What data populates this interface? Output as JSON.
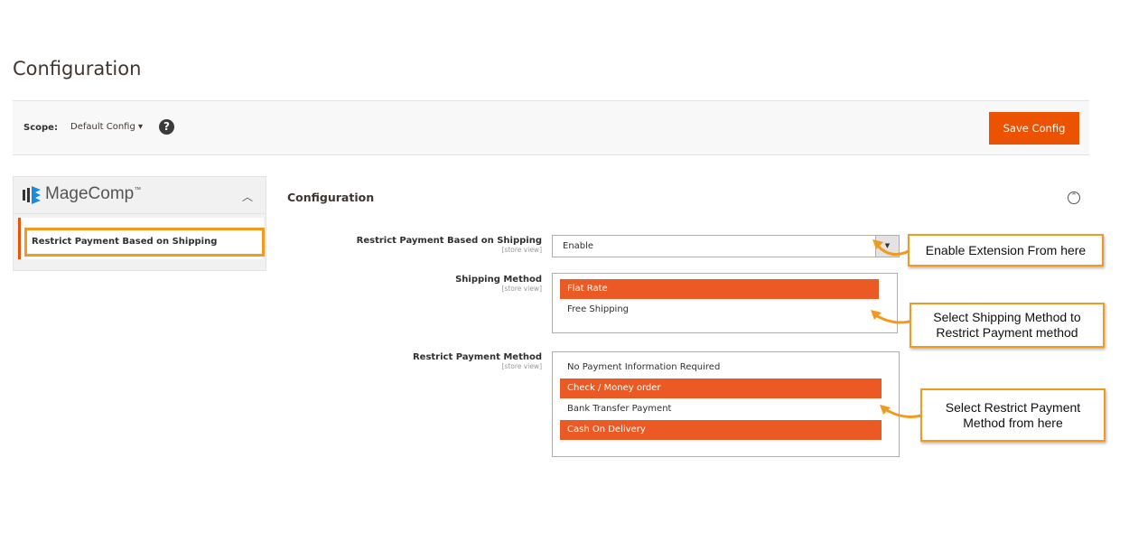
{
  "page": {
    "title": "Configuration"
  },
  "scope": {
    "label": "Scope:",
    "value": "Default Config",
    "help": "?"
  },
  "toolbar": {
    "save_label": "Save Config"
  },
  "sidebar": {
    "brand": "MageComp",
    "brand_tm": "™",
    "items": [
      {
        "label": "Restrict Payment Based on Shipping"
      }
    ]
  },
  "section": {
    "title": "Configuration"
  },
  "fields": [
    {
      "label": "Restrict Payment Based on Shipping",
      "scope": "[store view]",
      "value": "Enable"
    },
    {
      "label": "Shipping Method",
      "scope": "[store view]",
      "options": [
        {
          "label": "Flat Rate",
          "selected": true
        },
        {
          "label": "Free Shipping",
          "selected": false
        }
      ]
    },
    {
      "label": "Restrict Payment Method",
      "scope": "[store view]",
      "options": [
        {
          "label": "No Payment Information Required",
          "selected": false
        },
        {
          "label": "Check / Money order",
          "selected": true
        },
        {
          "label": "Bank Transfer Payment",
          "selected": false
        },
        {
          "label": "Cash On Delivery",
          "selected": true
        }
      ]
    }
  ],
  "annotations": [
    "Enable Extension From here",
    "Select Shipping Method to Restrict Payment method",
    "Select Restrict Payment Method from here"
  ],
  "colors": {
    "accent": "#eb5202",
    "highlight": "#f39a1e",
    "selected": "#eb5a24"
  }
}
